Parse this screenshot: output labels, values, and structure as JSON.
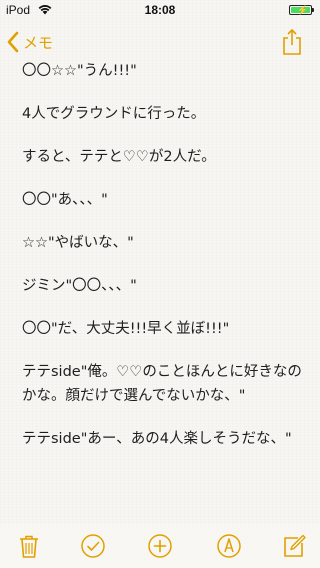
{
  "status_bar": {
    "carrier": "iPod",
    "time": "18:08"
  },
  "nav": {
    "back_label": "メモ"
  },
  "colors": {
    "accent": "#e0a000",
    "battery": "#4cd964"
  },
  "note": {
    "lines": [
      "〇〇☆☆\"うん!!!\"",
      "4人でグラウンドに行った。",
      "すると、テテと♡♡が2人だ。",
      "〇〇\"あ、、、\"",
      "☆☆\"やばいな、\"",
      "ジミン\"〇〇、、、\"",
      "〇〇\"だ、大丈夫!!!早く並ぼ!!!\"",
      "テテside\"俺。♡♡のことほんとに好きなのかな。顔だけで選んでないかな、\"",
      "テテside\"あー、あの4人楽しそうだな、\""
    ]
  },
  "toolbar": {
    "icons": [
      "trash-icon",
      "checkmark-icon",
      "add-icon",
      "markup-icon",
      "compose-icon"
    ]
  }
}
